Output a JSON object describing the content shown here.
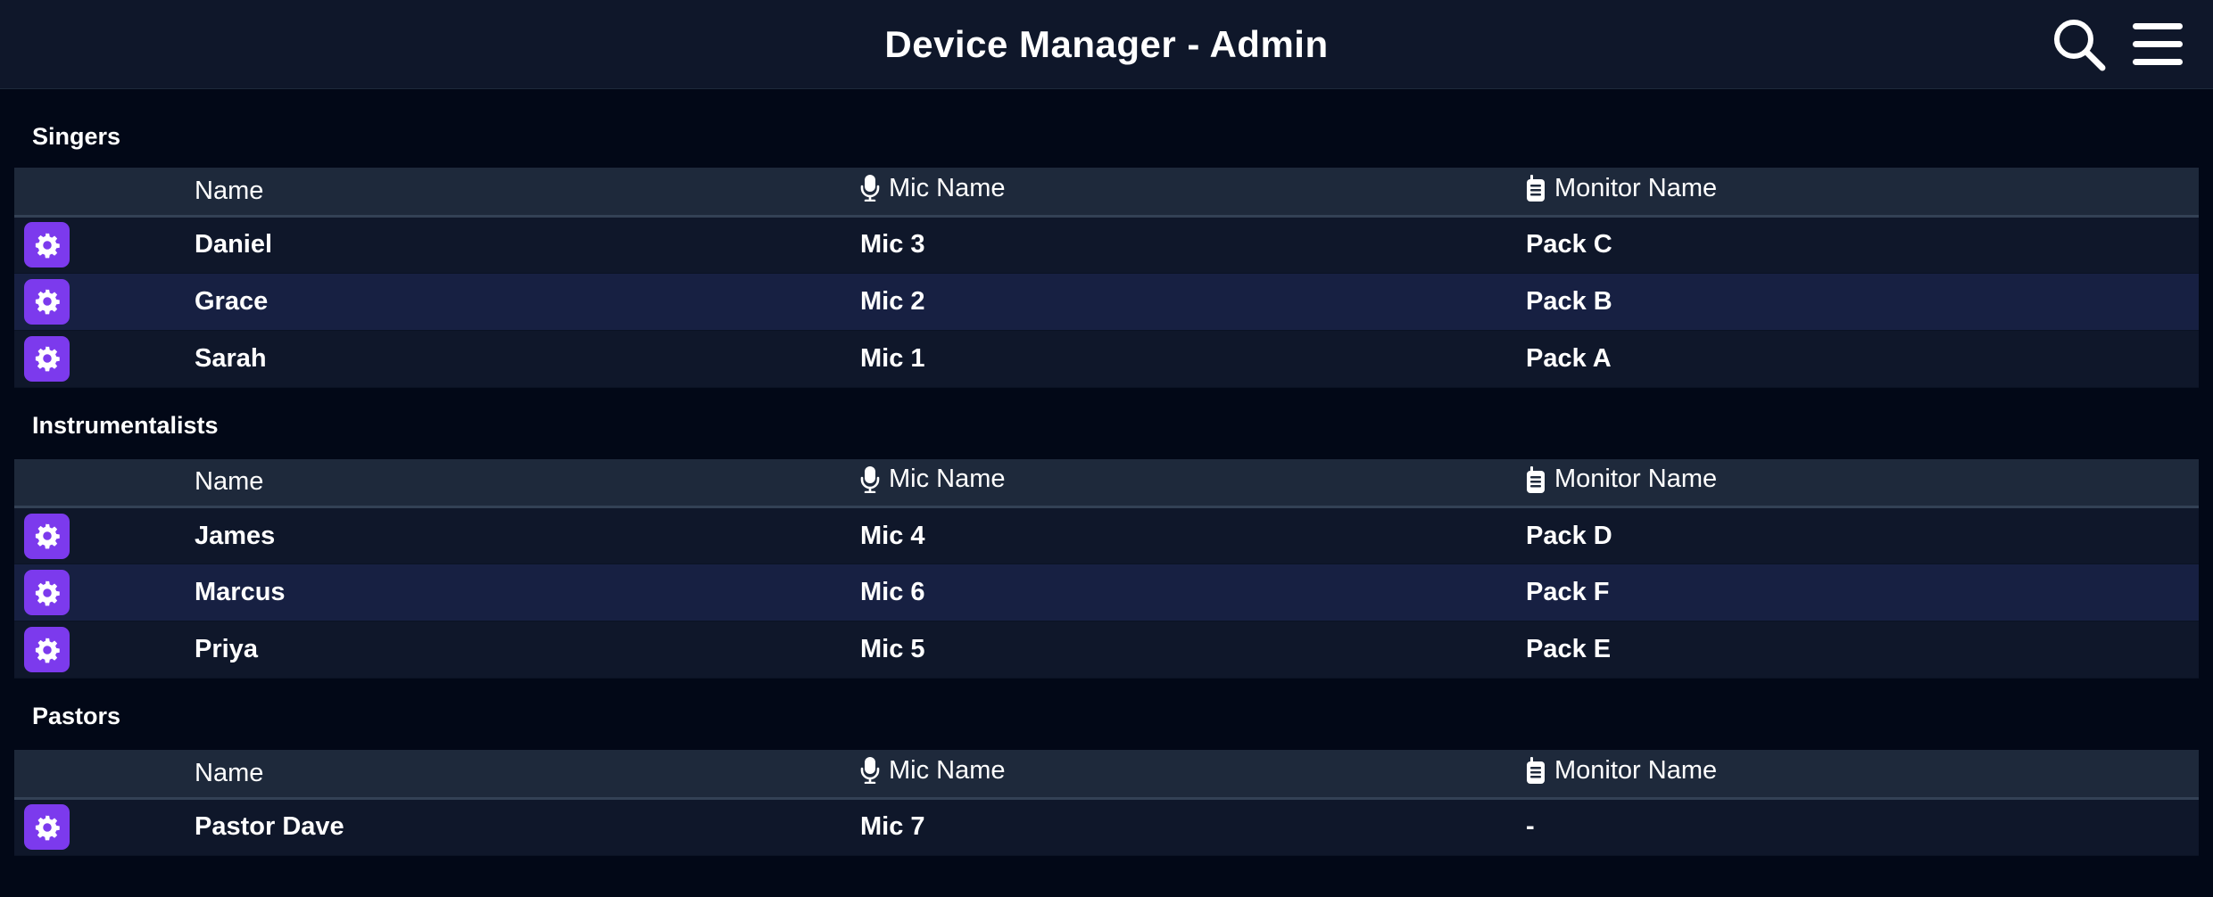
{
  "header": {
    "title": "Device Manager - Admin",
    "search_icon": "search-icon",
    "menu_icon": "hamburger-menu-icon"
  },
  "colors": {
    "header_bg": "#0f172a",
    "page_bg": "#020817",
    "table_head_bg": "#1e293b",
    "row_odd_bg": "#0f172a",
    "row_even_bg": "#172042",
    "accent": "#7c3aed"
  },
  "columns": {
    "name": "Name",
    "mic": "Mic Name",
    "monitor": "Monitor Name",
    "mic_icon": "microphone-icon",
    "monitor_icon": "monitor-pack-icon",
    "row_action_icon": "gear-icon"
  },
  "sections": [
    {
      "title": "Singers",
      "rows": [
        {
          "name": "Daniel",
          "mic": "Mic 3",
          "monitor": "Pack C"
        },
        {
          "name": "Grace",
          "mic": "Mic 2",
          "monitor": "Pack B"
        },
        {
          "name": "Sarah",
          "mic": "Mic 1",
          "monitor": "Pack A"
        }
      ]
    },
    {
      "title": "Instrumentalists",
      "rows": [
        {
          "name": "James",
          "mic": "Mic 4",
          "monitor": "Pack D"
        },
        {
          "name": "Marcus",
          "mic": "Mic 6",
          "monitor": "Pack F"
        },
        {
          "name": "Priya",
          "mic": "Mic 5",
          "monitor": "Pack E"
        }
      ]
    },
    {
      "title": "Pastors",
      "rows": [
        {
          "name": "Pastor Dave",
          "mic": "Mic 7",
          "monitor": "-"
        }
      ]
    }
  ]
}
